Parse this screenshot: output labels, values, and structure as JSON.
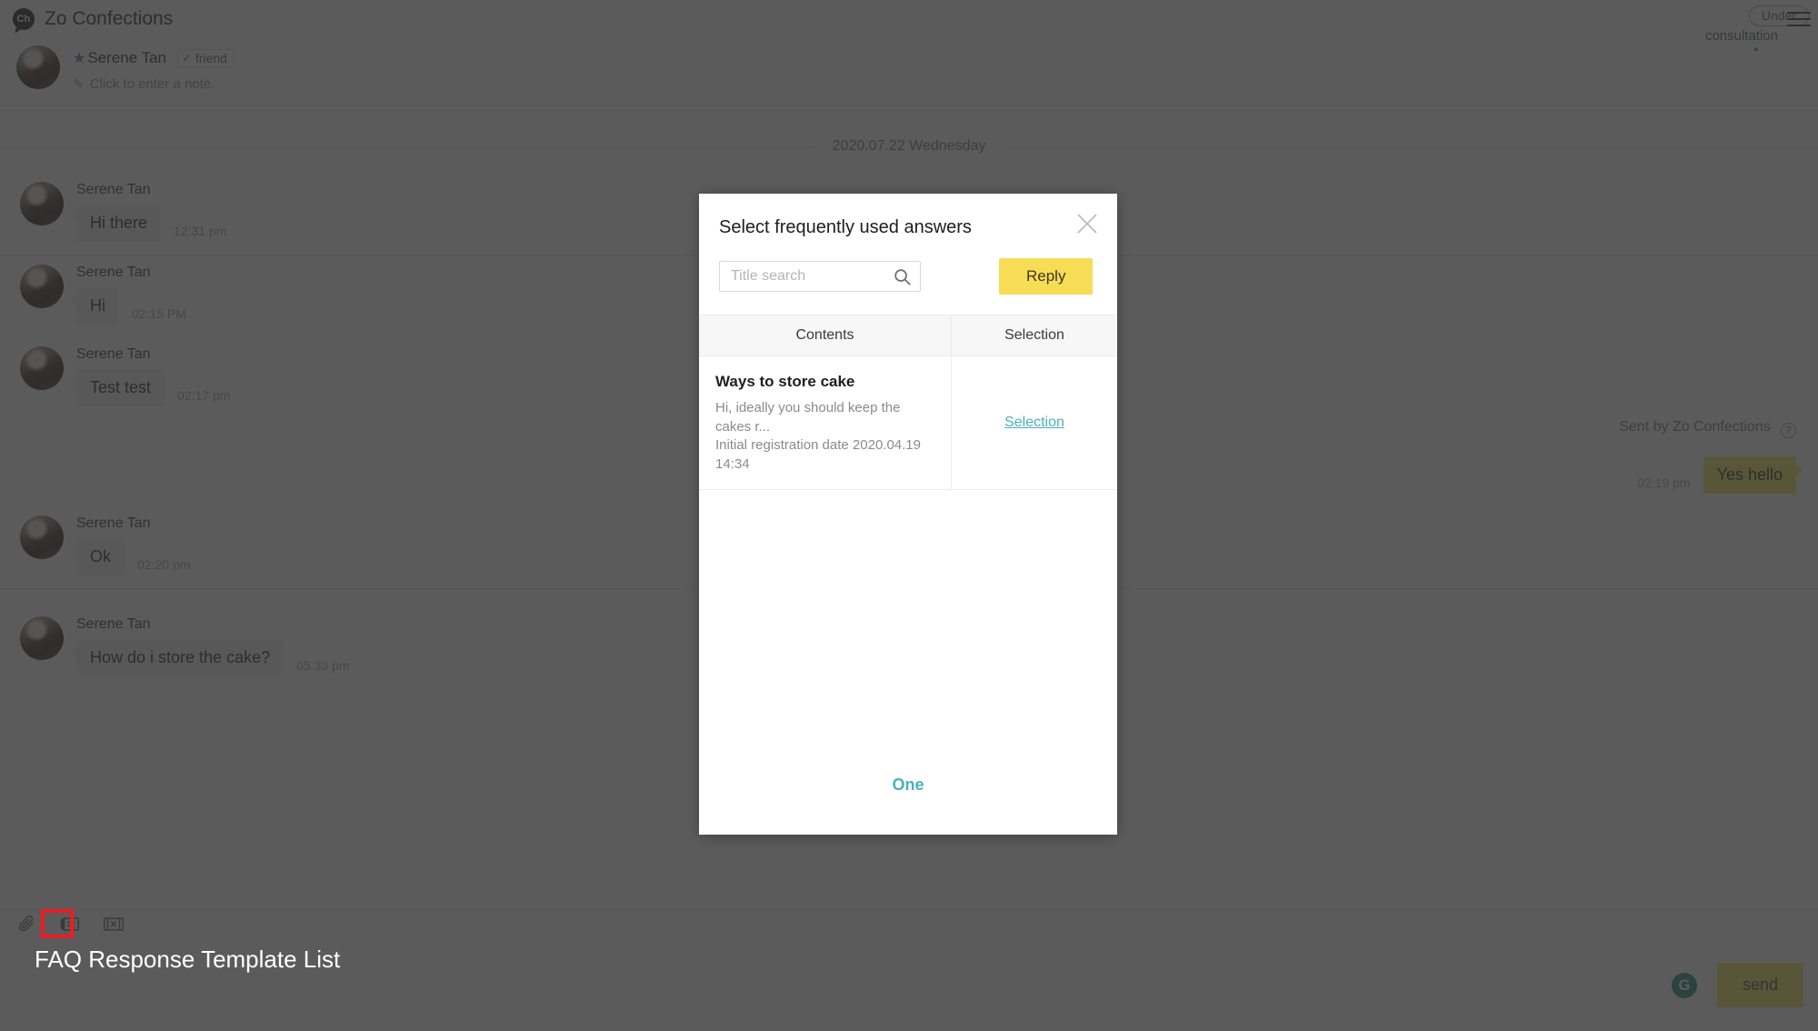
{
  "app": {
    "logo_text": "Ch",
    "title": "Zo Confections",
    "status_badge": "Under",
    "status_sub": "consultation",
    "status_caret": "▸",
    "menu_icon": "hamburger-icon"
  },
  "contact": {
    "star_icon": "★",
    "name": "Serene Tan",
    "friend_check": "✓",
    "friend_label": "friend",
    "pencil_icon": "✎",
    "note_placeholder": "Click to enter a note."
  },
  "conversation": {
    "date_divider": "2020.07.22 Wednesday",
    "messages": [
      {
        "sender": "Serene Tan",
        "text": "Hi there",
        "time": "12:31 pm",
        "side": "in"
      },
      {
        "sender": "Serene Tan",
        "text": "Hi",
        "time": "02:15 PM",
        "side": "in"
      },
      {
        "sender": "Serene Tan",
        "text": "Test test",
        "time": "02:17 pm",
        "side": "in"
      },
      {
        "sender": "Zo Confections",
        "text": "Yes hello",
        "time": "02:19 pm",
        "side": "out",
        "sent_by": "Sent by Zo Confections"
      },
      {
        "sender": "Serene Tan",
        "text": "Ok",
        "time": "02:20 pm",
        "side": "in"
      },
      {
        "sender": "Serene Tan",
        "text": "How do i store the cake?",
        "time": "05:33 pm",
        "side": "in"
      }
    ]
  },
  "composer": {
    "attach_icon": "paperclip-icon",
    "faq_icon": "faq-template-icon",
    "coupon_icon": "coupon-icon",
    "grammarly_icon": "G",
    "send_label": "send"
  },
  "modal": {
    "title": "Select frequently used answers",
    "close_icon": "close-icon",
    "search_placeholder": "Title search",
    "search_value": "",
    "search_icon": "search-icon",
    "reply_label": "Reply",
    "columns": [
      "Contents",
      "Selection"
    ],
    "rows": [
      {
        "title": "Ways to store cake",
        "preview": "Hi, ideally you should keep the cakes r...",
        "registered": "Initial registration date 2020.04.19 14:34",
        "action": "Selection"
      }
    ],
    "pagination": "One"
  },
  "annotation": {
    "label": "FAQ Response Template List",
    "highlight_color": "#ec1c24"
  },
  "colors": {
    "accent_yellow": "#f7dd55",
    "link_teal": "#4db0bd",
    "badge_border": "#9aa3a3"
  }
}
